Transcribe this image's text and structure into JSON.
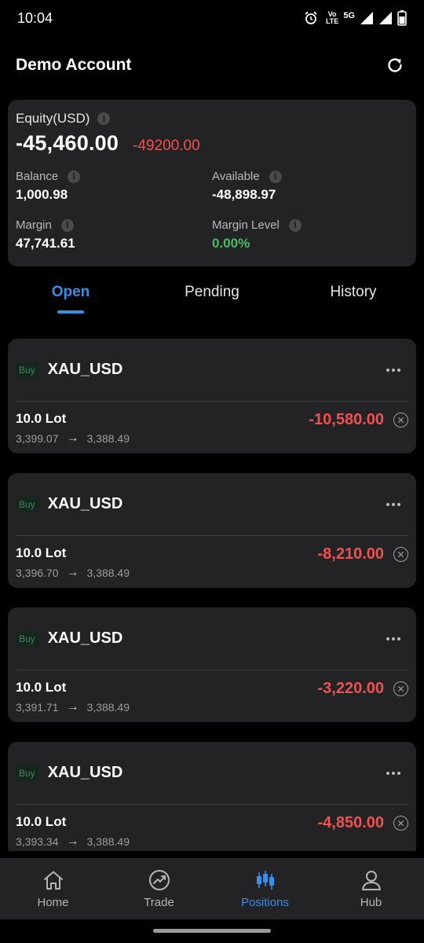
{
  "status_bar": {
    "time": "10:04",
    "volte_top": "Vo",
    "volte_bottom": "LTE",
    "network": "5G",
    "icons": [
      "alarm-icon",
      "volte-icon",
      "signal-icon",
      "signal-icon",
      "battery-icon"
    ]
  },
  "header": {
    "title": "Demo Account",
    "refresh_icon": "refresh-icon"
  },
  "account": {
    "equity_label": "Equity(USD)",
    "equity_value": "-45,460.00",
    "equity_change": "-49200.00",
    "balance_label": "Balance",
    "balance_value": "1,000.98",
    "available_label": "Available",
    "available_value": "-48,898.97",
    "margin_label": "Margin",
    "margin_value": "47,741.61",
    "margin_level_label": "Margin Level",
    "margin_level_value": "0.00%",
    "info_icon": "i"
  },
  "tabs": [
    {
      "label": "Open",
      "active": true
    },
    {
      "label": "Pending",
      "active": false
    },
    {
      "label": "History",
      "active": false
    }
  ],
  "positions": [
    {
      "side": "Buy",
      "symbol": "XAU_USD",
      "lot": "10.0 Lot",
      "open_price": "3,399.07",
      "current_price": "3,388.49",
      "pnl": "-10,580.00"
    },
    {
      "side": "Buy",
      "symbol": "XAU_USD",
      "lot": "10.0 Lot",
      "open_price": "3,396.70",
      "current_price": "3,388.49",
      "pnl": "-8,210.00"
    },
    {
      "side": "Buy",
      "symbol": "XAU_USD",
      "lot": "10.0 Lot",
      "open_price": "3,391.71",
      "current_price": "3,388.49",
      "pnl": "-3,220.00"
    },
    {
      "side": "Buy",
      "symbol": "XAU_USD",
      "lot": "10.0 Lot",
      "open_price": "3,393.34",
      "current_price": "3,388.49",
      "pnl": "-4,850.00"
    }
  ],
  "bottom_nav": [
    {
      "label": "Home",
      "icon": "home-icon",
      "active": false
    },
    {
      "label": "Trade",
      "icon": "trade-chart-icon",
      "active": false
    },
    {
      "label": "Positions",
      "icon": "candlestick-icon",
      "active": true
    },
    {
      "label": "Hub",
      "icon": "user-icon",
      "active": false
    }
  ],
  "colors": {
    "background": "#000000",
    "card": "#232325",
    "accent": "#3a8ee8",
    "loss": "#f0514e",
    "profit": "#4fb865"
  }
}
